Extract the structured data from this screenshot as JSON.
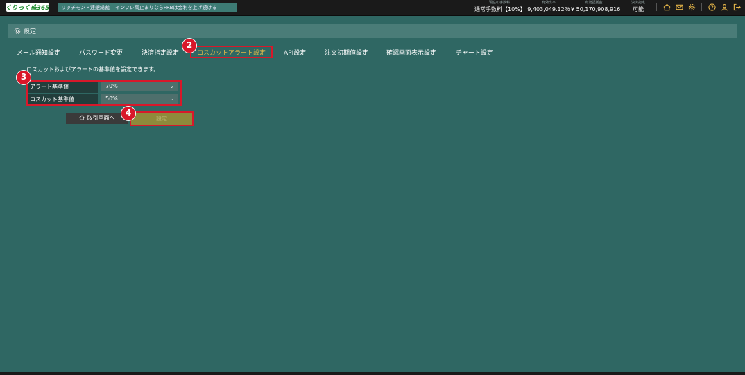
{
  "header": {
    "logo_text": "くりっく株365",
    "ticker_source": "リッチモンド連銀総裁",
    "ticker_text": "インフレ高止まりならFRBは金利を上げ続ける",
    "stats": [
      {
        "label": "現在の手数料",
        "value": "通常手数料【10%】"
      },
      {
        "label": "有効比率",
        "value": "9,403,049.12％"
      },
      {
        "label": "有効証拠金",
        "value": "¥ 50,170,908,916"
      },
      {
        "label": "決済指定",
        "value": "可能"
      }
    ],
    "icons": [
      "home-icon",
      "mail-icon",
      "gear-icon",
      "help-icon",
      "user-icon",
      "logout-icon"
    ]
  },
  "settings": {
    "title": "設定"
  },
  "tabs": [
    {
      "label": "メール通知設定"
    },
    {
      "label": "パスワード変更"
    },
    {
      "label": "決済指定設定"
    },
    {
      "label": "ロスカットアラート設定",
      "active": true
    },
    {
      "label": "API設定"
    },
    {
      "label": "注文初期値設定"
    },
    {
      "label": "確認画面表示設定"
    },
    {
      "label": "チャート設定"
    }
  ],
  "description": "ロスカットおよびアラートの基準値を設定できます。",
  "form": {
    "alert_label": "アラート基準値",
    "alert_value": "70%",
    "losscut_label": "ロスカット基準値",
    "losscut_value": "50%"
  },
  "buttons": {
    "back_label": "取引画面へ",
    "submit_label": "設定"
  },
  "markers": [
    "2",
    "3",
    "4"
  ],
  "colors": {
    "background": "#2f6763",
    "accent": "#e0b84a",
    "highlight": "#d8182a"
  }
}
